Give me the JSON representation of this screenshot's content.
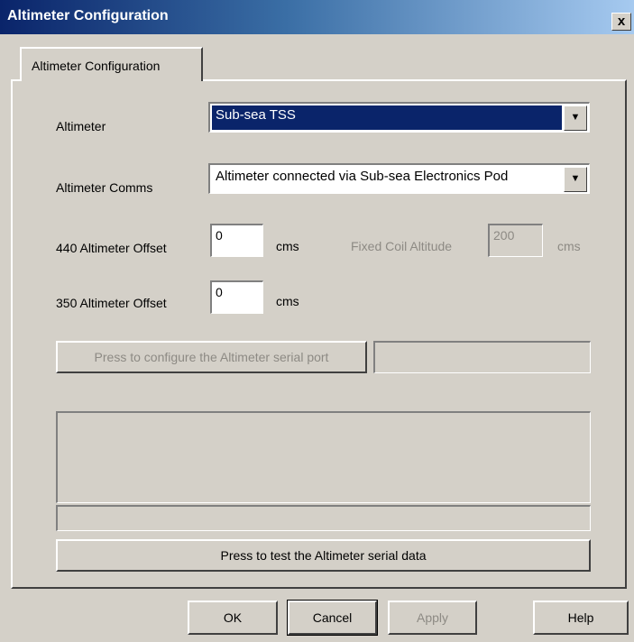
{
  "window": {
    "title": "Altimeter Configuration",
    "close_glyph": "x"
  },
  "tab": {
    "label": "Altimeter Configuration"
  },
  "altimeter": {
    "label": "Altimeter",
    "selected": "Sub-sea TSS",
    "arrow_icon": "chevron-down-icon"
  },
  "comms": {
    "label": "Altimeter Comms",
    "selected": "Altimeter connected via Sub-sea Electronics Pod",
    "arrow_icon": "chevron-down-icon"
  },
  "offset440": {
    "label": "440 Altimeter Offset",
    "value": "0",
    "unit": "cms"
  },
  "offset350": {
    "label": "350 Altimeter Offset",
    "value": "0",
    "unit": "cms"
  },
  "fixed_coil": {
    "label": "Fixed Coil Altitude",
    "value": "200",
    "unit": "cms"
  },
  "serial": {
    "configure_label": "Press to configure the Altimeter serial port",
    "port_value": "",
    "test_label": "Press to test the Altimeter serial data"
  },
  "footer": {
    "ok": "OK",
    "cancel": "Cancel",
    "apply": "Apply",
    "help": "Help"
  },
  "colors": {
    "face": "#d4d0c8",
    "title_active": "#0a246a",
    "selection": "#0a246a",
    "disabled_text": "#8d8a84"
  }
}
